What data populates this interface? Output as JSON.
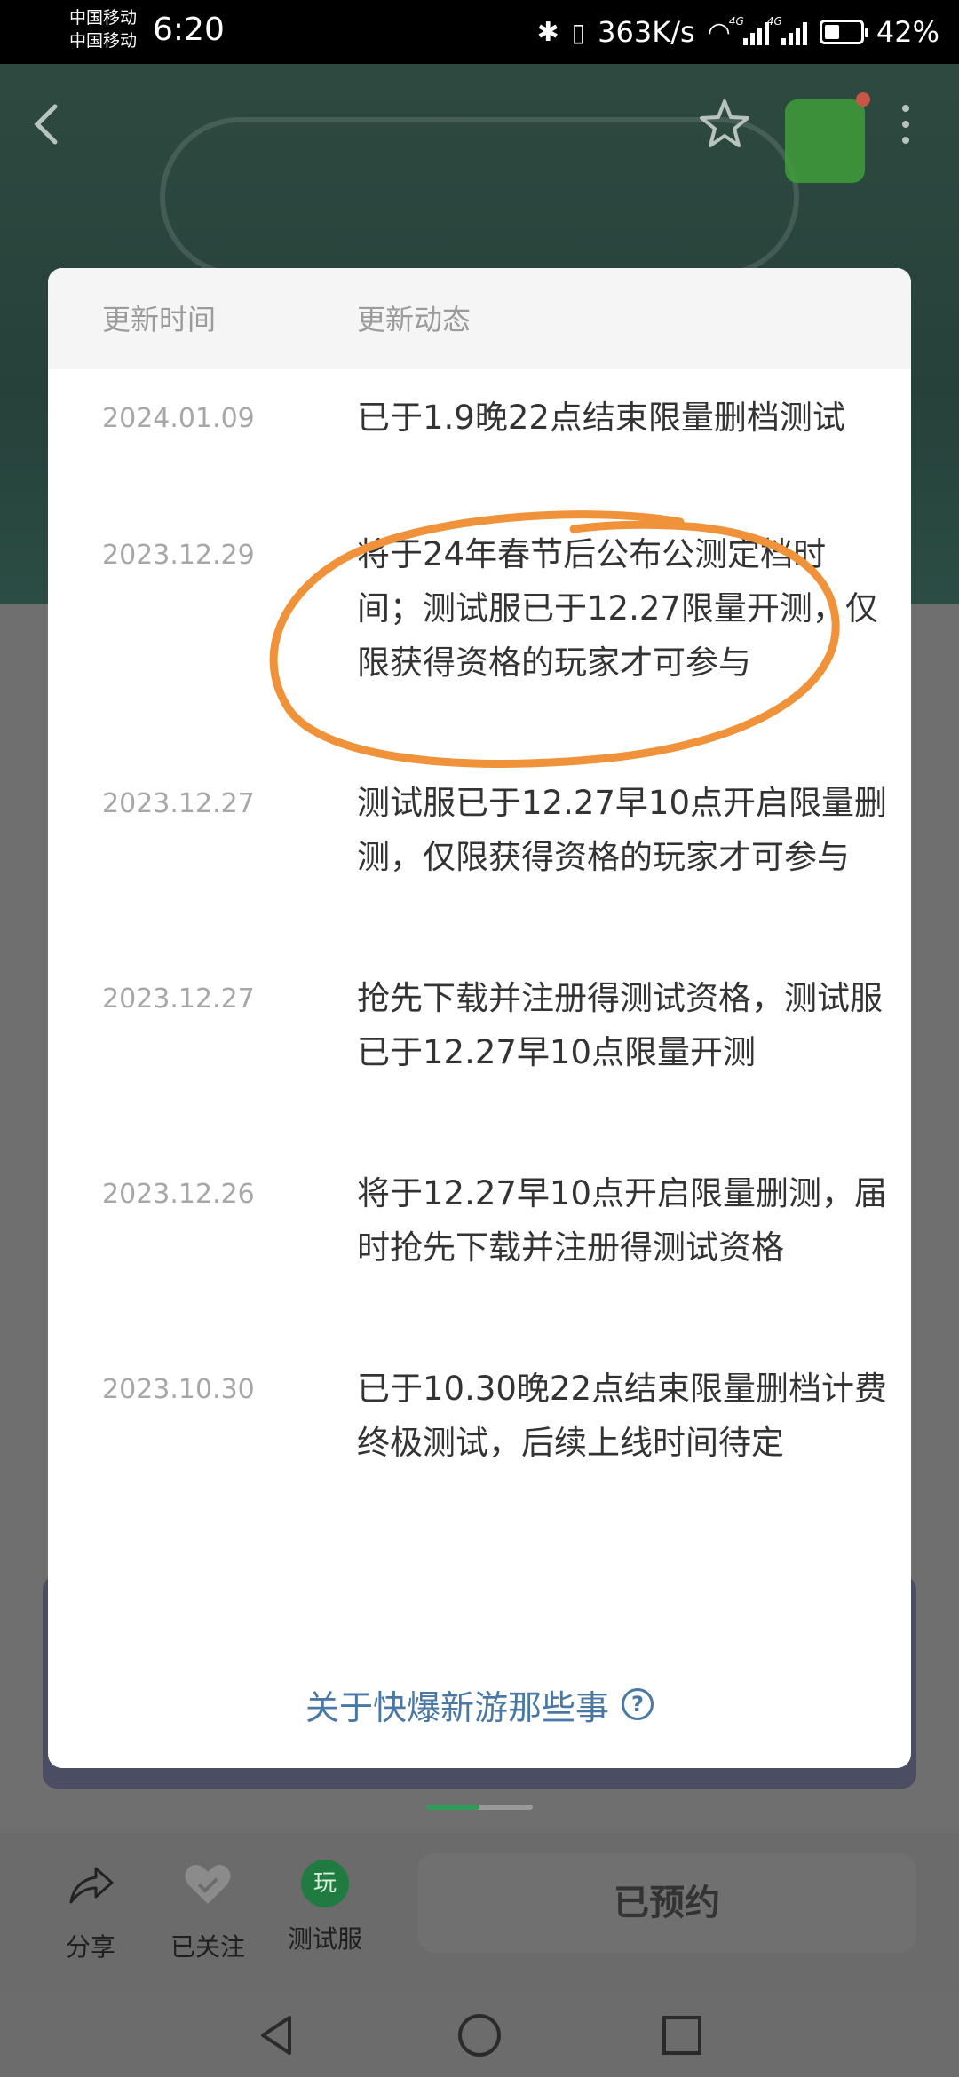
{
  "status_bar": {
    "carrier_1": "中国移动",
    "carrier_2": "中国移动",
    "time": "6:20",
    "net_speed": "363K/s",
    "signal_tag": "4G",
    "battery": "42%",
    "battery_level": 0.42
  },
  "dialog": {
    "header_time": "更新时间",
    "header_update": "更新动态",
    "rows": [
      {
        "date": "2024.01.09",
        "text": "已于1.9晚22点结束限量删档测试"
      },
      {
        "date": "2023.12.29",
        "text": "将于24年春节后公布公测定档时间；测试服已于12.27限量开测，仅限获得资格的玩家才可参与"
      },
      {
        "date": "2023.12.27",
        "text": "测试服已于12.27早10点开启限量删测，仅限获得资格的玩家才可参与"
      },
      {
        "date": "2023.12.27",
        "text": "抢先下载并注册得测试资格，测试服已于12.27早10点限量开测"
      },
      {
        "date": "2023.12.26",
        "text": "将于12.27早10点开启限量删测，届时抢先下载并注册得测试资格"
      },
      {
        "date": "2023.10.30",
        "text": "已于10.30晚22点结束限量删档计费终极测试，后续上线时间待定"
      }
    ],
    "about_link": "关于快爆新游那些事",
    "help_glyph": "?"
  },
  "action_bar": {
    "share_label": "分享",
    "follow_label": "已关注",
    "test_badge": "玩",
    "test_label": "测试服",
    "reserve_label": "已预约"
  },
  "colors": {
    "annotation": "#f0923a",
    "link": "#4a78a5",
    "brand_green": "#1f7b40"
  },
  "icons": [
    "back-icon",
    "star-icon",
    "download-icon",
    "more-icon",
    "share-icon",
    "heart-icon",
    "question-icon",
    "nav-back-icon",
    "nav-home-icon",
    "nav-recent-icon"
  ]
}
